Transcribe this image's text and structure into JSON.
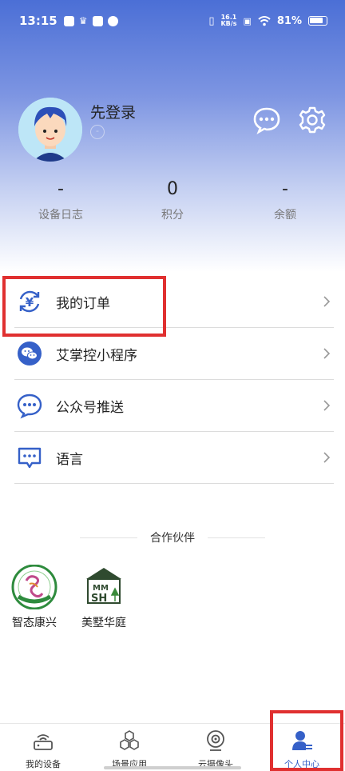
{
  "status_bar": {
    "time": "13:15",
    "net_speed_value": "16.1",
    "net_speed_unit": "KB/s",
    "battery": "81%"
  },
  "profile": {
    "name": "先登录",
    "sub_icon": "-"
  },
  "stats": [
    {
      "value": "-",
      "label": "设备日志"
    },
    {
      "value": "0",
      "label": "积分"
    },
    {
      "value": "-",
      "label": "余额"
    }
  ],
  "menu": [
    {
      "label": "我的订单",
      "icon": "yuan-refresh-icon"
    },
    {
      "label": "艾掌控小程序",
      "icon": "wechat-icon"
    },
    {
      "label": "公众号推送",
      "icon": "chat-bubble-icon"
    },
    {
      "label": "语言",
      "icon": "message-icon"
    }
  ],
  "partners": {
    "title": "合作伙伴",
    "items": [
      {
        "name": "智态康兴",
        "logo_text": "智态康兴"
      },
      {
        "name": "美墅华庭",
        "logo_text": "SH"
      }
    ]
  },
  "tabbar": [
    {
      "label": "我的设备",
      "icon": "router-icon",
      "active": false
    },
    {
      "label": "场景应用",
      "icon": "hexagons-icon",
      "active": false
    },
    {
      "label": "云摄像头",
      "icon": "camera-icon",
      "active": false
    },
    {
      "label": "个人中心",
      "icon": "person-icon",
      "active": true
    }
  ],
  "colors": {
    "accent": "#3560c8",
    "highlight": "#e03030",
    "header_top": "#4b6fd6"
  }
}
